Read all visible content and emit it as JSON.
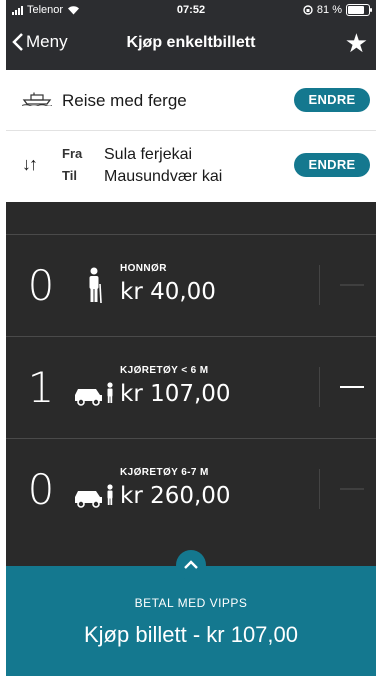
{
  "status_bar": {
    "carrier": "Telenor",
    "time": "07:52",
    "battery": "81 %"
  },
  "nav": {
    "back_label": "Meny",
    "title": "Kjøp enkeltbillett",
    "favorite_icon": "star-icon"
  },
  "trip": {
    "mode_label": "Reise med ferge",
    "change_label": "ENDRE",
    "from_key": "Fra",
    "from_value": "Sula ferjekai",
    "to_key": "Til",
    "to_value": "Mausundvær kai"
  },
  "tickets": [
    {
      "quantity": "0",
      "name": "HONNØR",
      "price": "kr 40,00",
      "icon": "elderly-person-icon"
    },
    {
      "quantity": "1",
      "name": "KJØRETØY < 6 M",
      "price": "kr 107,00",
      "icon": "car-with-driver-icon"
    },
    {
      "quantity": "0",
      "name": "KJØRETØY 6-7 M",
      "price": "kr 260,00",
      "icon": "car-with-driver-icon"
    }
  ],
  "purchase": {
    "pay_method": "BETAL MED VIPPS",
    "buy_label": "Kjøp billett",
    "separator": " - ",
    "total": "kr 107,00"
  },
  "colors": {
    "accent": "#14788f",
    "dark_bg": "#2a2a2a",
    "nav_bg": "#2c2d30"
  }
}
